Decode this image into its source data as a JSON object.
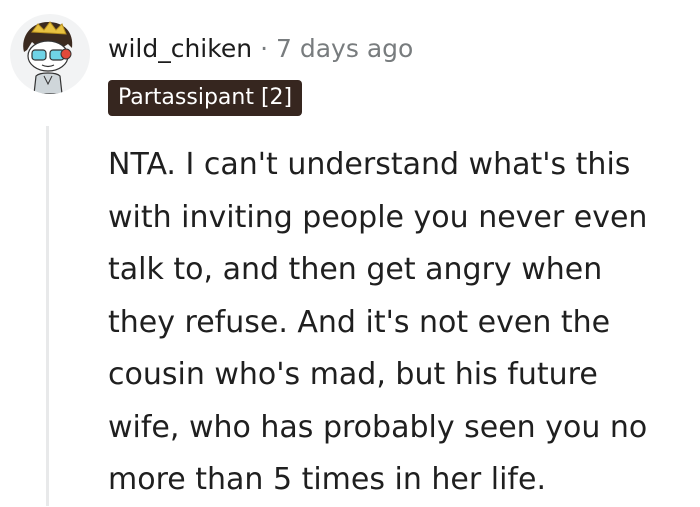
{
  "comment": {
    "author": "wild_chiken",
    "separator": "·",
    "timestamp": "7 days ago",
    "flair": "Partassipant [2]",
    "body_lines": [
      "NTA. I can't understand what's this",
      "with inviting people you never even",
      "talk to, and then get angry when",
      "they refuse. And it's not even the",
      "cousin who's mad, but his future",
      "wife, who has probably seen you no",
      "more than 5 times in her life."
    ]
  },
  "colors": {
    "flair_bg": "#36261f",
    "meta_gray": "#787c7e",
    "thread_line": "#e8e9ea",
    "avatar_bg": "#f2f3f4"
  },
  "icons": {
    "avatar": "snoo-avatar-icon"
  }
}
